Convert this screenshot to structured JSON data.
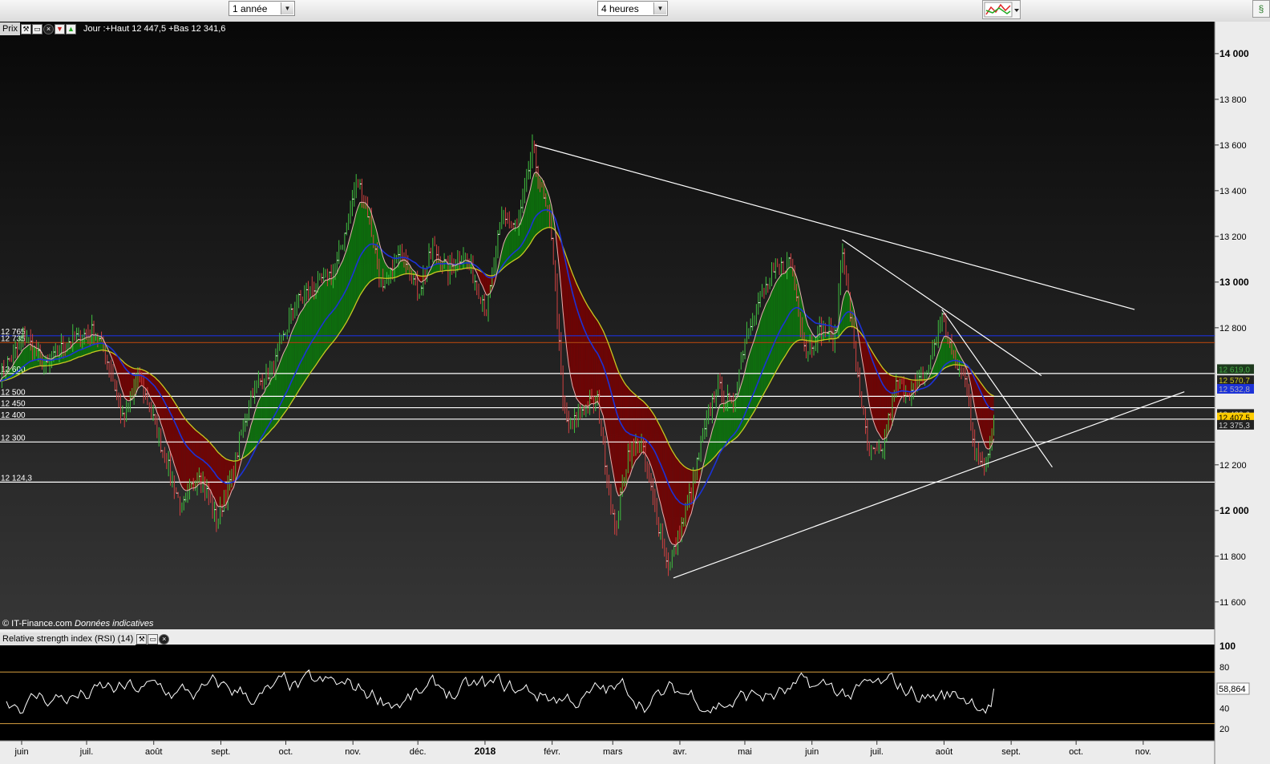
{
  "toolbar": {
    "period_value": "1 année",
    "interval_value": "4 heures"
  },
  "price_panel": {
    "label": "Prix",
    "summary": "Jour :+Haut 12 447,5 +Bas 12 341,6",
    "credit_source": "© IT-Finance.com",
    "credit_note": "Données indicatives"
  },
  "rsi_panel": {
    "label": "Relative strength index (RSI) (14)",
    "current_value": "58,864"
  },
  "colors": {
    "background": "#1a1a1a",
    "bull_fill": "#0c7a0c",
    "bear_fill": "#7a0000",
    "blue_ma": "#1c32d8",
    "yellow_ma": "#c8c820",
    "trendline": "#ffffff",
    "rsi_line": "#ffffff",
    "rsi_band": "#d8a040",
    "last_price_bg": "#ffcc00"
  },
  "chart_data": [
    {
      "type": "line",
      "subtype": "candlestick",
      "scale": "linear",
      "grid": false,
      "legend": "none",
      "x_ticks": [
        "juin",
        "juil.",
        "août",
        "sept.",
        "oct.",
        "nov.",
        "déc.",
        "2018",
        "févr.",
        "mars",
        "avr.",
        "mai",
        "juin",
        "juil.",
        "août",
        "sept.",
        "oct.",
        "nov."
      ],
      "x_tick_dates": [
        "2017-06-01",
        "2017-07-01",
        "2017-08-01",
        "2017-09-01",
        "2017-10-01",
        "2017-11-01",
        "2017-12-01",
        "2018-01-01",
        "2018-02-01",
        "2018-03-01",
        "2018-04-01",
        "2018-05-01",
        "2018-06-01",
        "2018-07-01",
        "2018-08-01",
        "2018-09-01",
        "2018-10-01",
        "2018-11-01"
      ],
      "xlim": [
        "2017-05-22",
        "2018-12-04"
      ],
      "y_ticks": [
        "14 000",
        "13 800",
        "13 600",
        "13 400",
        "13 200",
        "13 000",
        "12 800",
        "12 200",
        "12 000",
        "11 800",
        "11 600"
      ],
      "ylim": [
        11480,
        14140
      ],
      "price_path": [
        {
          "date": "2017-05-22",
          "value": 12600
        },
        {
          "date": "2017-06-03",
          "value": 12760
        },
        {
          "date": "2017-06-12",
          "value": 12620
        },
        {
          "date": "2017-06-22",
          "value": 12740
        },
        {
          "date": "2017-07-05",
          "value": 12790
        },
        {
          "date": "2017-07-12",
          "value": 12620
        },
        {
          "date": "2017-07-18",
          "value": 12380
        },
        {
          "date": "2017-07-25",
          "value": 12600
        },
        {
          "date": "2017-08-08",
          "value": 12180
        },
        {
          "date": "2017-08-14",
          "value": 12000
        },
        {
          "date": "2017-08-22",
          "value": 12180
        },
        {
          "date": "2017-08-30",
          "value": 11950
        },
        {
          "date": "2017-09-06",
          "value": 12150
        },
        {
          "date": "2017-09-15",
          "value": 12520
        },
        {
          "date": "2017-09-26",
          "value": 12640
        },
        {
          "date": "2017-10-05",
          "value": 12900
        },
        {
          "date": "2017-10-16",
          "value": 13000
        },
        {
          "date": "2017-10-24",
          "value": 13050
        },
        {
          "date": "2017-11-03",
          "value": 13450
        },
        {
          "date": "2017-11-08",
          "value": 13300
        },
        {
          "date": "2017-11-15",
          "value": 12950
        },
        {
          "date": "2017-11-24",
          "value": 13150
        },
        {
          "date": "2017-12-01",
          "value": 12950
        },
        {
          "date": "2017-12-08",
          "value": 13150
        },
        {
          "date": "2017-12-15",
          "value": 13050
        },
        {
          "date": "2017-12-22",
          "value": 13130
        },
        {
          "date": "2018-01-02",
          "value": 12880
        },
        {
          "date": "2018-01-09",
          "value": 13300
        },
        {
          "date": "2018-01-16",
          "value": 13230
        },
        {
          "date": "2018-01-23",
          "value": 13590
        },
        {
          "date": "2018-01-27",
          "value": 13400
        },
        {
          "date": "2018-02-01",
          "value": 13200
        },
        {
          "date": "2018-02-06",
          "value": 12450
        },
        {
          "date": "2018-02-09",
          "value": 12350
        },
        {
          "date": "2018-02-15",
          "value": 12450
        },
        {
          "date": "2018-02-22",
          "value": 12480
        },
        {
          "date": "2018-03-02",
          "value": 11900
        },
        {
          "date": "2018-03-08",
          "value": 12250
        },
        {
          "date": "2018-03-14",
          "value": 12300
        },
        {
          "date": "2018-03-23",
          "value": 11900
        },
        {
          "date": "2018-03-27",
          "value": 11750
        },
        {
          "date": "2018-04-04",
          "value": 12000
        },
        {
          "date": "2018-04-10",
          "value": 12250
        },
        {
          "date": "2018-04-18",
          "value": 12550
        },
        {
          "date": "2018-04-25",
          "value": 12450
        },
        {
          "date": "2018-05-02",
          "value": 12800
        },
        {
          "date": "2018-05-09",
          "value": 12950
        },
        {
          "date": "2018-05-16",
          "value": 13050
        },
        {
          "date": "2018-05-22",
          "value": 13100
        },
        {
          "date": "2018-05-29",
          "value": 12700
        },
        {
          "date": "2018-06-06",
          "value": 12800
        },
        {
          "date": "2018-06-12",
          "value": 12750
        },
        {
          "date": "2018-06-15",
          "value": 13170
        },
        {
          "date": "2018-06-20",
          "value": 12750
        },
        {
          "date": "2018-06-27",
          "value": 12250
        },
        {
          "date": "2018-07-03",
          "value": 12250
        },
        {
          "date": "2018-07-10",
          "value": 12550
        },
        {
          "date": "2018-07-17",
          "value": 12520
        },
        {
          "date": "2018-07-24",
          "value": 12600
        },
        {
          "date": "2018-07-31",
          "value": 12850
        },
        {
          "date": "2018-08-06",
          "value": 12650
        },
        {
          "date": "2018-08-12",
          "value": 12550
        },
        {
          "date": "2018-08-15",
          "value": 12250
        },
        {
          "date": "2018-08-20",
          "value": 12200
        },
        {
          "date": "2018-08-24",
          "value": 12407.5
        }
      ],
      "horizontal_levels": [
        {
          "label": "12 765",
          "value": 12765
        },
        {
          "label": "12 735",
          "value": 12735
        },
        {
          "label": "12 600",
          "value": 12600
        },
        {
          "label": "12 500",
          "value": 12500
        },
        {
          "label": "12 450",
          "value": 12450
        },
        {
          "label": "12 400",
          "value": 12400
        },
        {
          "label": "12 300",
          "value": 12300
        },
        {
          "label": "12 124,3",
          "value": 12124.3
        }
      ],
      "trendlines": [
        {
          "from": {
            "date": "2018-01-24",
            "value": 13600
          },
          "to": {
            "date": "2018-10-28",
            "value": 12880
          }
        },
        {
          "from": {
            "date": "2018-06-15",
            "value": 13185
          },
          "to": {
            "date": "2018-09-15",
            "value": 12590
          }
        },
        {
          "from": {
            "date": "2018-07-31",
            "value": 12880
          },
          "to": {
            "date": "2018-09-20",
            "value": 12190
          }
        },
        {
          "from": {
            "date": "2018-03-29",
            "value": 11705
          },
          "to": {
            "date": "2018-11-20",
            "value": 12520
          }
        }
      ],
      "right_labels": [
        {
          "label": "12 619,0",
          "value": 12619
        },
        {
          "label": "12 570,7",
          "value": 12570.7
        },
        {
          "label": "12 532,8",
          "value": 12532.8
        },
        {
          "label": "12 422,6",
          "value": 12422.6
        },
        {
          "label": "12 407,5",
          "value": 12407.5
        },
        {
          "label": "12 375,3",
          "value": 12375.3
        }
      ],
      "last_price": 12407.5
    },
    {
      "type": "line",
      "title": "Relative strength index (RSI) (14)",
      "ylim": [
        10,
        100
      ],
      "y_ticks": [
        "100",
        "80",
        "40",
        "20"
      ],
      "bands": [
        75,
        25
      ],
      "last_value": 58.864
    }
  ]
}
